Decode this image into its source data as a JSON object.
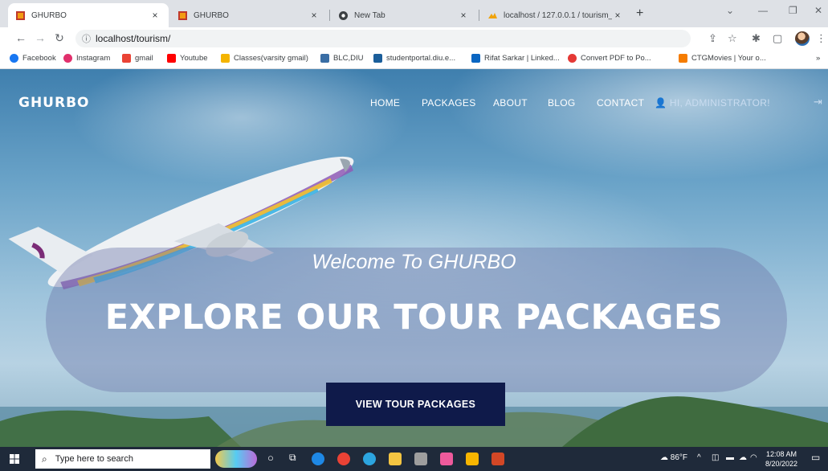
{
  "browser": {
    "tabs": [
      {
        "title": "GHURBO",
        "active": true,
        "favicon": "ghurbo-favicon"
      },
      {
        "title": "GHURBO",
        "active": false,
        "favicon": "ghurbo-favicon"
      },
      {
        "title": "New Tab",
        "active": false,
        "favicon": "chrome-favicon"
      },
      {
        "title": "localhost / 127.0.0.1 / tourism_di",
        "active": false,
        "favicon": "phpmyadmin-favicon"
      }
    ],
    "close_glyph": "×",
    "new_tab_glyph": "+",
    "url": "localhost/tourism/",
    "bookmarks": [
      {
        "label": "Facebook",
        "color": "#1877f2"
      },
      {
        "label": "Instagram",
        "color": "#e1306c"
      },
      {
        "label": "gmail",
        "color": "#ea4335"
      },
      {
        "label": "Youtube",
        "color": "#ff0000"
      },
      {
        "label": "Classes(varsity gmail)",
        "color": "#f4b400"
      },
      {
        "label": "BLC,DIU",
        "color": "#3a6ea5"
      },
      {
        "label": "studentportal.diu.e...",
        "color": "#1b5e9a"
      },
      {
        "label": "Rifat Sarkar | Linked...",
        "color": "#0a66c2"
      },
      {
        "label": "Convert PDF to Po...",
        "color": "#e53935"
      },
      {
        "label": "CTGMovies | Your o...",
        "color": "#f57c00"
      }
    ]
  },
  "site": {
    "brand": "GHURBO",
    "nav": {
      "home": "HOME",
      "packages": "PACKAGES",
      "about": "ABOUT",
      "blog": "BLOG",
      "contact": "CONTACT",
      "user": "HI, ADMINISTRATOR!"
    },
    "hero": {
      "welcome": "Welcome To GHURBO",
      "headline": "EXPLORE OUR TOUR PACKAGES",
      "cta": "VIEW TOUR PACKAGES"
    },
    "colors": {
      "cta_bg": "#0f1a4a",
      "nav_text": "#ffffff"
    }
  },
  "taskbar": {
    "search_placeholder": "Type here to search",
    "temperature": "86°F",
    "time": "12:08 AM",
    "date": "8/20/2022"
  }
}
